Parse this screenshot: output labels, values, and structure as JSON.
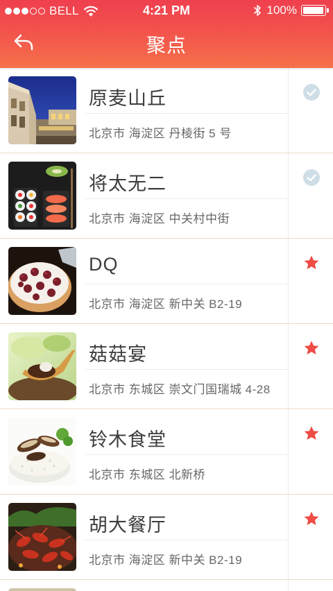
{
  "status_bar": {
    "carrier": "BELL",
    "time": "4:21 PM",
    "battery_percent": "100%",
    "battery_level": 1.0,
    "signal_dots_filled": 3,
    "signal_dots_total": 5
  },
  "nav": {
    "title": "聚点",
    "back_icon": "back-arrow-icon"
  },
  "colors": {
    "header_top": "#ef3f4e",
    "header_bottom": "#f5714a",
    "star": "#ee4c45",
    "check": "#c9dbe6",
    "row_divider": "#ebdcc4"
  },
  "places": [
    {
      "name": "原麦山丘",
      "address": "北京市 海淀区 丹棱街 5 号",
      "status": "visited",
      "status_icon": "check-circle-icon",
      "thumb": "building"
    },
    {
      "name": "将太无二",
      "address": "北京市 海淀区 中关村中街",
      "status": "visited",
      "status_icon": "check-circle-icon",
      "thumb": "sushi"
    },
    {
      "name": "DQ",
      "address": "北京市 海淀区 新中关 B2-19",
      "status": "favorite",
      "status_icon": "star-icon",
      "thumb": "cake"
    },
    {
      "name": "菇菇宴",
      "address": "北京市 东城区 崇文门国瑞城 4-28",
      "status": "favorite",
      "status_icon": "star-icon",
      "thumb": "mushroom"
    },
    {
      "name": "铃木食堂",
      "address": "北京市 东城区 北新桥",
      "status": "favorite",
      "status_icon": "star-icon",
      "thumb": "rice"
    },
    {
      "name": "胡大餐厅",
      "address": "北京市 海淀区 新中关 B2-19",
      "status": "favorite",
      "status_icon": "star-icon",
      "thumb": "crayfish"
    }
  ]
}
